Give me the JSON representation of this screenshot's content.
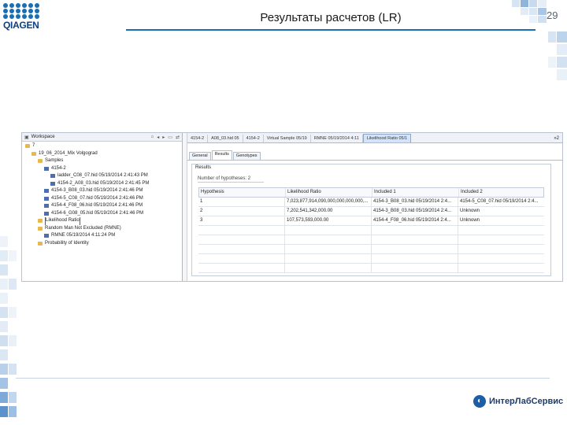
{
  "header": {
    "logo_text": "QIAGEN",
    "title": "Результаты расчетов (LR)",
    "page_number": "29"
  },
  "footer": {
    "brand": "ИнтерЛабСервис"
  },
  "colors": {
    "accent": "#1a6fb4",
    "highlight": "#e02020",
    "active_tab": "#d3e3fb"
  },
  "workspace": {
    "title": "Workspace",
    "toolbar_icons": [
      "home-icon",
      "back-icon",
      "forward-icon",
      "collapse-icon",
      "link-icon"
    ],
    "tree": [
      {
        "label": "7",
        "icon": "folder",
        "indent": 0
      },
      {
        "label": "19_06_2014_Mix Volgograd",
        "icon": "folder",
        "indent": 1
      },
      {
        "label": "Samples",
        "icon": "folder",
        "indent": 2
      },
      {
        "label": "4154-2",
        "icon": "sample",
        "indent": 3
      },
      {
        "label": "ladder_C08_07.hid 05/19/2014 2:41:43 PM",
        "icon": "sample",
        "indent": 4
      },
      {
        "label": "4154-2_A08_03.hid 05/19/2014 2:41:45 PM",
        "icon": "sample",
        "indent": 4
      },
      {
        "label": "4154-3_B08_03.hid 05/19/2014 2:41:46 PM",
        "icon": "sample",
        "indent": 3
      },
      {
        "label": "4154-5_C08_07.hid 05/19/2014 2:41:46 PM",
        "icon": "sample",
        "indent": 3
      },
      {
        "label": "4154-4_F08_06.hid 05/19/2014 2:41:46 PM",
        "icon": "sample",
        "indent": 3
      },
      {
        "label": "4154-6_G08_05.hid 05/19/2014 2:41:46 PM",
        "icon": "sample",
        "indent": 3
      },
      {
        "label": "Likelihood Ratio",
        "icon": "folder",
        "indent": 2,
        "highlight": true
      },
      {
        "label": "Random Man Not Excluded (RMNE)",
        "icon": "folder",
        "indent": 2
      },
      {
        "label": "RMNE 05/19/2014 4:11:24 PM",
        "icon": "sample",
        "indent": 3
      },
      {
        "label": "Probability of Identity",
        "icon": "folder",
        "indent": 2
      }
    ]
  },
  "editor": {
    "tabs": [
      {
        "label": "4154-2",
        "active": false
      },
      {
        "label": "A08_03.hid 05",
        "active": false
      },
      {
        "label": "4154-2",
        "active": false
      },
      {
        "label": "Virtual Sample 05/19",
        "active": false
      },
      {
        "label": "RMNE 05/19/2014 4:11",
        "active": false
      },
      {
        "label": "Likelihood Ratio 05/1",
        "active": true
      }
    ],
    "tabs_more": "»2",
    "subtabs": [
      {
        "label": "General",
        "active": false
      },
      {
        "label": "Results",
        "active": true
      },
      {
        "label": "Genotypes",
        "active": false
      }
    ],
    "results": {
      "title": "Results",
      "num_hypotheses": "Number of hypotheses: 2",
      "columns": [
        "Hypothesis",
        "Likelihood Ratio",
        "Included 1",
        "Included 2"
      ],
      "rows": [
        [
          "1",
          "7,023,877,914,090,000,000,000,000,...",
          "4154-3_B08_03.hid 05/19/2014 2:4...",
          "4154-5_C08_07.hid 05/19/2014 2:4..."
        ],
        [
          "2",
          "7,202,541,342,000.00",
          "4154-3_B08_03.hid 05/19/2014 2:4...",
          "Unknown"
        ],
        [
          "3",
          "107,573,593,000.00",
          "4154-4_F08_06.hid 05/19/2014 2:4...",
          "Unknown"
        ]
      ]
    }
  }
}
